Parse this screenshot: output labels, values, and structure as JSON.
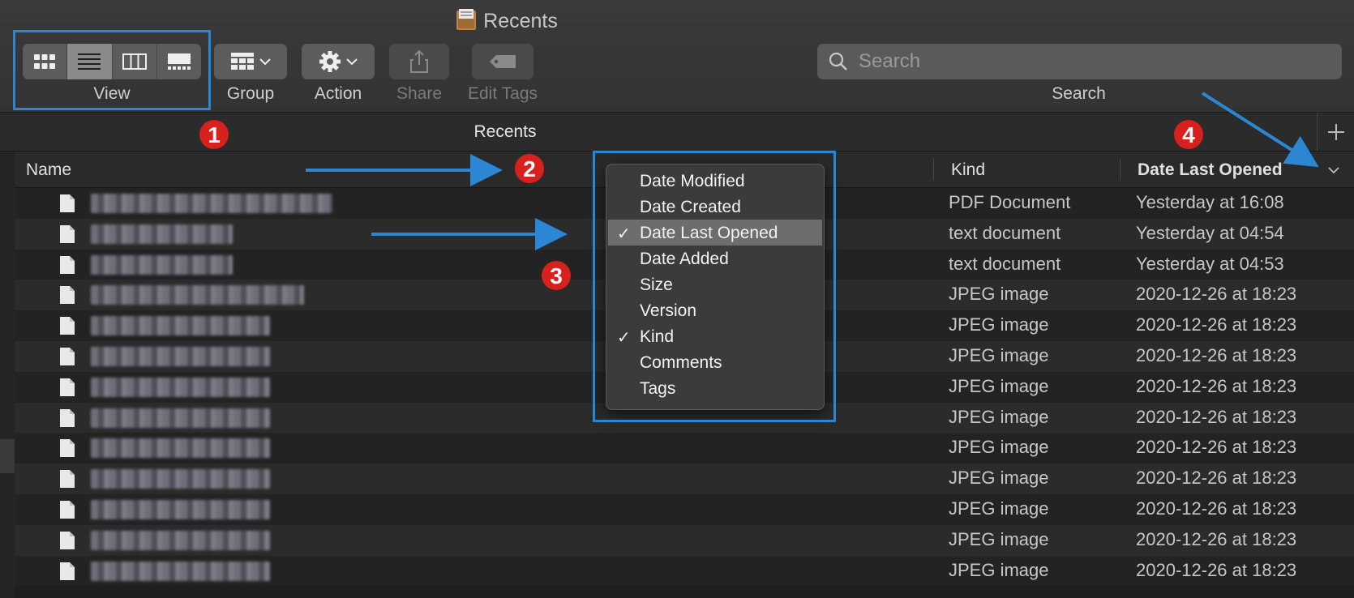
{
  "window": {
    "title": "Recents",
    "folder_icon": "recents-folder-icon"
  },
  "toolbar": {
    "view_label": "View",
    "view_modes": [
      {
        "name": "icon-view-icon",
        "selected": false
      },
      {
        "name": "list-view-icon",
        "selected": true
      },
      {
        "name": "column-view-icon",
        "selected": false
      },
      {
        "name": "gallery-view-icon",
        "selected": false
      }
    ],
    "group_label": "Group",
    "action_label": "Action",
    "share_label": "Share",
    "edit_tags_label": "Edit Tags",
    "search_label": "Search",
    "search_placeholder": "Search"
  },
  "tabbar": {
    "title": "Recents"
  },
  "columns": {
    "name": "Name",
    "kind": "Kind",
    "date": "Date Last Opened"
  },
  "files": [
    {
      "name": "Python_Crash_Course_2E.pdf",
      "kind": "PDF Document",
      "date": "Yesterday at 16:08"
    },
    {
      "name": "notes-index-01.txt",
      "kind": "text document",
      "date": "Yesterday at 04:54"
    },
    {
      "name": "notes-index-02.txt",
      "kind": "text document",
      "date": "Yesterday at 04:53"
    },
    {
      "name": "screenshot-2020-12-26.jpg",
      "kind": "JPEG image",
      "date": "2020-12-26 at 18:23"
    },
    {
      "name": "screenshot-1-1-8-2.jpg",
      "kind": "JPEG image",
      "date": "2020-12-26 at 18:23"
    },
    {
      "name": "screenshot-2-2-6-2.jpg",
      "kind": "JPEG image",
      "date": "2020-12-26 at 18:23"
    },
    {
      "name": "screenshot-3-3-7-2.jpg",
      "kind": "JPEG image",
      "date": "2020-12-26 at 18:23"
    },
    {
      "name": "screenshot-4-4-4-2.jpg",
      "kind": "JPEG image",
      "date": "2020-12-26 at 18:23"
    },
    {
      "name": "screenshot-5-5-5-2.jpg",
      "kind": "JPEG image",
      "date": "2020-12-26 at 18:23"
    },
    {
      "name": "screenshot-6-6-1-2.jpg",
      "kind": "JPEG image",
      "date": "2020-12-26 at 18:23"
    },
    {
      "name": "screenshot-7-7-3-2.jpg",
      "kind": "JPEG image",
      "date": "2020-12-26 at 18:23"
    },
    {
      "name": "screenshot-8-8-2-2.jpg",
      "kind": "JPEG image",
      "date": "2020-12-26 at 18:23"
    },
    {
      "name": "screenshot-9-9-1-2.jpg",
      "kind": "JPEG image",
      "date": "2020-12-26 at 18:23"
    }
  ],
  "column_menu": {
    "items": [
      {
        "label": "Date Modified",
        "checked": false,
        "highlighted": false
      },
      {
        "label": "Date Created",
        "checked": false,
        "highlighted": false
      },
      {
        "label": "Date Last Opened",
        "checked": true,
        "highlighted": true
      },
      {
        "label": "Date Added",
        "checked": false,
        "highlighted": false
      },
      {
        "label": "Size",
        "checked": false,
        "highlighted": false
      },
      {
        "label": "Version",
        "checked": false,
        "highlighted": false
      },
      {
        "label": "Kind",
        "checked": true,
        "highlighted": false
      },
      {
        "label": "Comments",
        "checked": false,
        "highlighted": false
      },
      {
        "label": "Tags",
        "checked": false,
        "highlighted": false
      }
    ],
    "check_glyph": "✓"
  },
  "annotations": {
    "badges": [
      "1",
      "2",
      "3",
      "4"
    ],
    "color": "#2b86d4",
    "badge_color": "#d6211d"
  }
}
